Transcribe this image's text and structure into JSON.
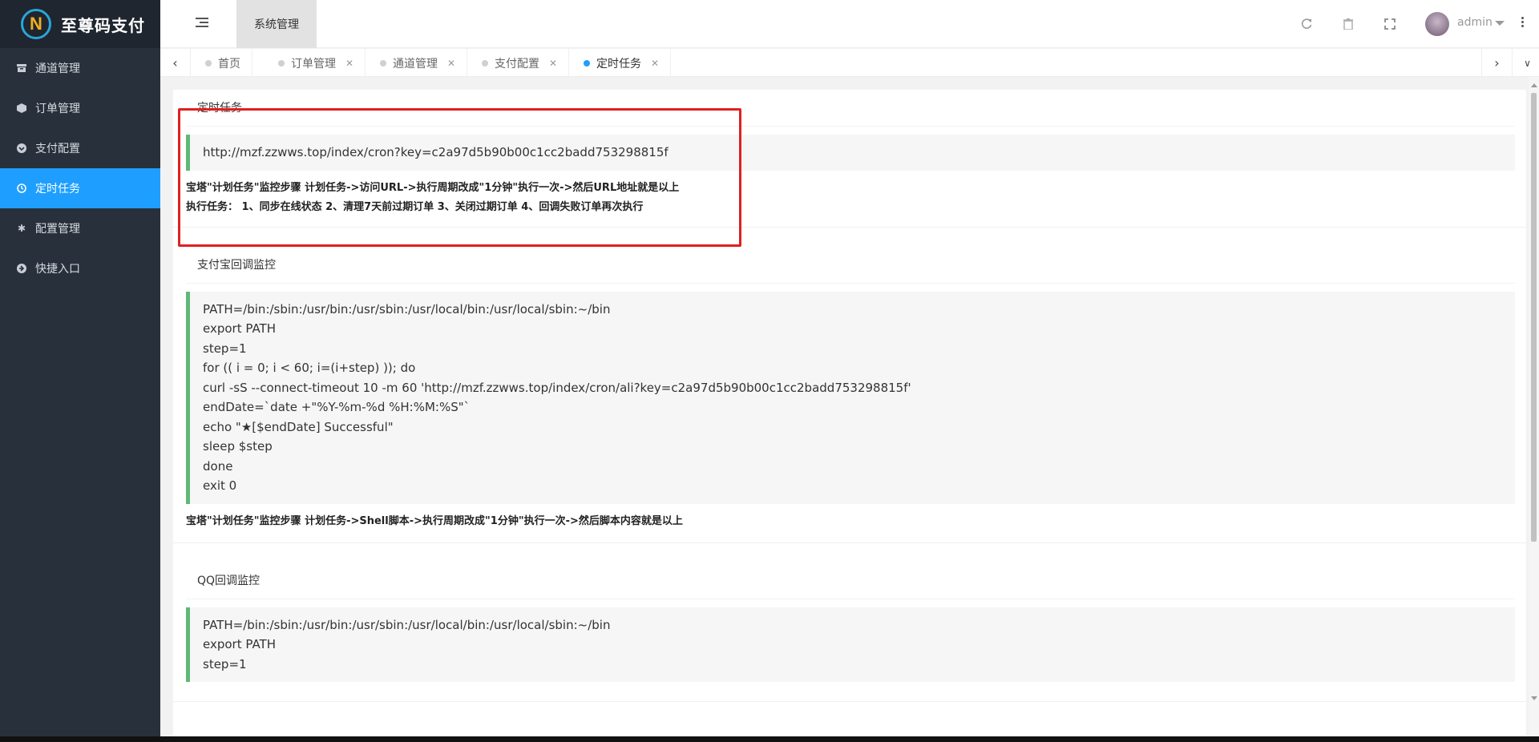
{
  "app": {
    "title": "至尊码支付"
  },
  "sidebar": {
    "items": [
      {
        "label": "通道管理",
        "icon": "archive-icon"
      },
      {
        "label": "订单管理",
        "icon": "cube-icon"
      },
      {
        "label": "支付配置",
        "icon": "chevron-circle-down-icon"
      },
      {
        "label": "定时任务",
        "icon": "clock-icon",
        "active": true
      },
      {
        "label": "配置管理",
        "icon": "asterisk-icon"
      },
      {
        "label": "快捷入口",
        "icon": "arrow-circle-right-icon"
      }
    ]
  },
  "header": {
    "system_tab": "系统管理",
    "user": "admin"
  },
  "tabs": [
    {
      "label": "首页",
      "closable": false
    },
    {
      "label": "订单管理",
      "closable": true
    },
    {
      "label": "通道管理",
      "closable": true
    },
    {
      "label": "支付配置",
      "closable": true
    },
    {
      "label": "定时任务",
      "closable": true,
      "active": true
    }
  ],
  "cards": {
    "cron": {
      "title": "定时任务",
      "url": "http://mzf.zzwws.top/index/cron?key=c2a97d5b90b00c1cc2badd753298815f",
      "note1": "宝塔\"计划任务\"监控步骤 计划任务->访问URL->执行周期改成\"1分钟\"执行一次->然后URL地址就是以上",
      "note2": "执行任务： 1、同步在线状态 2、清理7天前过期订单 3、关闭过期订单 4、回调失败订单再次执行"
    },
    "alipay": {
      "title": "支付宝回调监控",
      "script": "PATH=/bin:/sbin:/usr/bin:/usr/sbin:/usr/local/bin:/usr/local/sbin:~/bin\nexport PATH\nstep=1\nfor (( i = 0; i < 60; i=(i+step) )); do\ncurl -sS --connect-timeout 10 -m 60 'http://mzf.zzwws.top/index/cron/ali?key=c2a97d5b90b00c1cc2badd753298815f'\nendDate=`date +\"%Y-%m-%d %H:%M:%S\"`\necho \"★[$endDate] Successful\"\nsleep $step\ndone\nexit 0",
      "note": "宝塔\"计划任务\"监控步骤 计划任务->Shell脚本->执行周期改成\"1分钟\"执行一次->然后脚本内容就是以上"
    },
    "qq": {
      "title": "QQ回调监控",
      "script": "PATH=/bin:/sbin:/usr/bin:/usr/sbin:/usr/local/bin:/usr/local/sbin:~/bin\nexport PATH\nstep=1"
    }
  },
  "colors": {
    "sidebar_bg": "#28303b",
    "active_blue": "#1e9fff",
    "quote_border": "#5fb878",
    "highlight_red": "#e02020"
  }
}
